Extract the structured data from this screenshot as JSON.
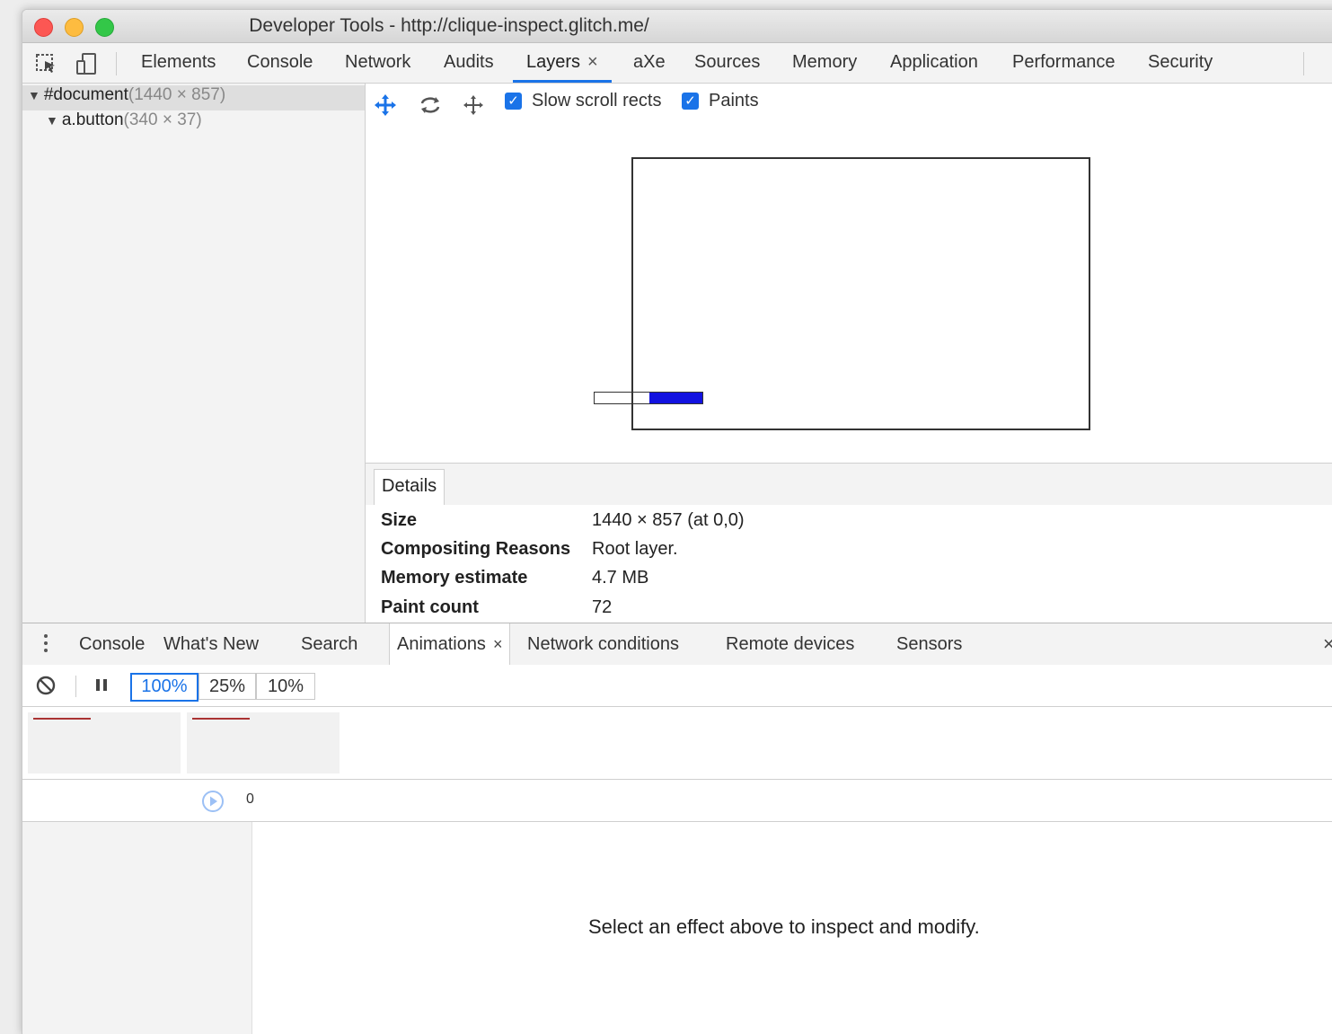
{
  "window": {
    "title": "Developer Tools - http://clique-inspect.glitch.me/"
  },
  "main_tabs": [
    {
      "label": "Elements"
    },
    {
      "label": "Console"
    },
    {
      "label": "Network"
    },
    {
      "label": "Audits"
    },
    {
      "label": "Layers",
      "active": true,
      "close": "×"
    },
    {
      "label": "aXe"
    },
    {
      "label": "Sources"
    },
    {
      "label": "Memory"
    },
    {
      "label": "Application"
    },
    {
      "label": "Performance"
    },
    {
      "label": "Security"
    }
  ],
  "layers_tree": [
    {
      "name": "#document",
      "size": "(1440 × 857)",
      "selected": true
    },
    {
      "name": "a.button",
      "size": "(340 × 37)",
      "selected": false
    }
  ],
  "view_toolbar": {
    "slow_scroll_rects": {
      "label": "Slow scroll rects",
      "checked": true
    },
    "paints": {
      "label": "Paints",
      "checked": true
    },
    "tools": [
      "pan-icon",
      "rotate-icon",
      "move-icon"
    ]
  },
  "details": {
    "tab_label": "Details",
    "rows": [
      {
        "key": "Size",
        "value": "1440 × 857 (at 0,0)"
      },
      {
        "key": "Compositing Reasons",
        "value": "Root layer."
      },
      {
        "key": "Memory estimate",
        "value": "4.7 MB"
      },
      {
        "key": "Paint count",
        "value": "72"
      }
    ]
  },
  "drawer_tabs": [
    {
      "label": "Console"
    },
    {
      "label": "What's New"
    },
    {
      "label": "Search"
    },
    {
      "label": "Animations",
      "active": true,
      "close": "×"
    },
    {
      "label": "Network conditions"
    },
    {
      "label": "Remote devices"
    },
    {
      "label": "Sensors"
    }
  ],
  "drawer_close": "×",
  "animations": {
    "speeds": [
      "100%",
      "25%",
      "10%"
    ],
    "selected_speed": "100%",
    "timeline_start": "0",
    "empty_message": "Select an effect above to inspect and modify."
  },
  "colors": {
    "accent": "#1a73e8",
    "layer_button_fill": "#1212e0"
  }
}
